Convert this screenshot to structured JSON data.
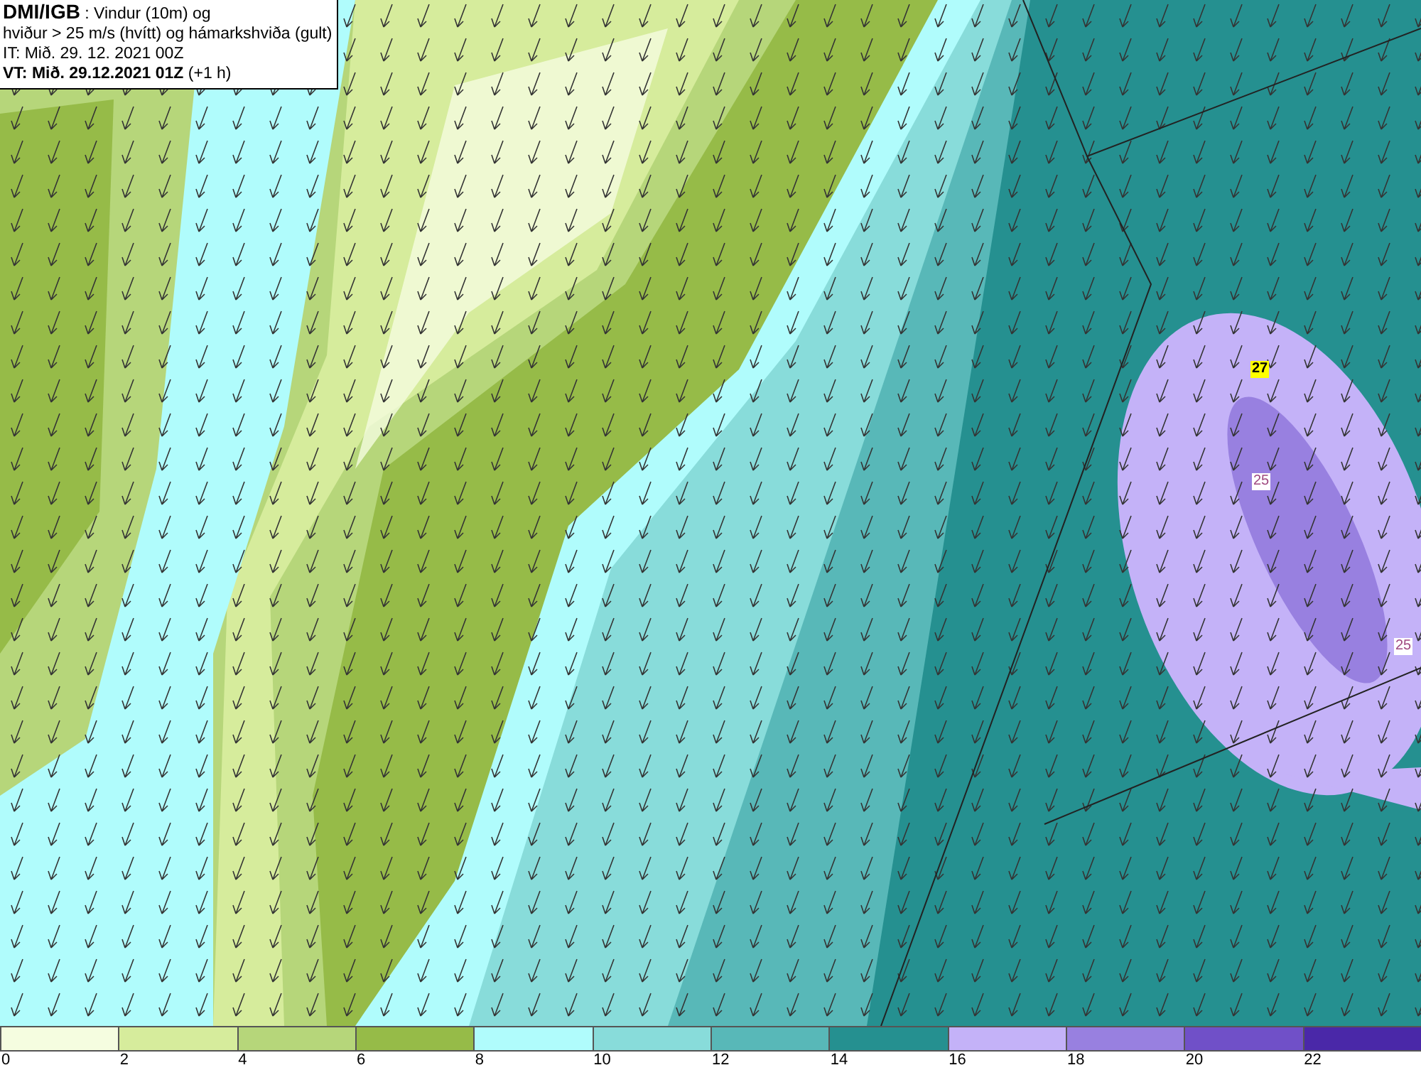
{
  "header": {
    "lines": [
      "**DMI/IGB** : Vindur (10m) og",
      "hviður > 25 m/s (hvítt) og hámarkshviða (gult)",
      "IT: Mið. 29. 12. 2021 00Z",
      "**VT: Mið. 29.12.2021 01Z** (+1 h)"
    ]
  },
  "contour_labels": [
    {
      "text": "27",
      "kind": "max"
    },
    {
      "text": "25",
      "kind": "gust"
    },
    {
      "text": "25",
      "kind": "gust"
    }
  ],
  "legend": [
    {
      "label": "0",
      "color": "#f5fde0"
    },
    {
      "label": "2",
      "color": "#d6ec9c"
    },
    {
      "label": "4",
      "color": "#b6d67a"
    },
    {
      "label": "6",
      "color": "#96bb48"
    },
    {
      "label": "8",
      "color": "#b0fcfc"
    },
    {
      "label": "10",
      "color": "#88dcda"
    },
    {
      "label": "12",
      "color": "#58b8b8"
    },
    {
      "label": "14",
      "color": "#259090"
    },
    {
      "label": "16",
      "color": "#c4b2f8"
    },
    {
      "label": "18",
      "color": "#9880e0"
    },
    {
      "label": "20",
      "color": "#7050c8"
    },
    {
      "label": "22",
      "color": "#4a28a8"
    }
  ]
}
